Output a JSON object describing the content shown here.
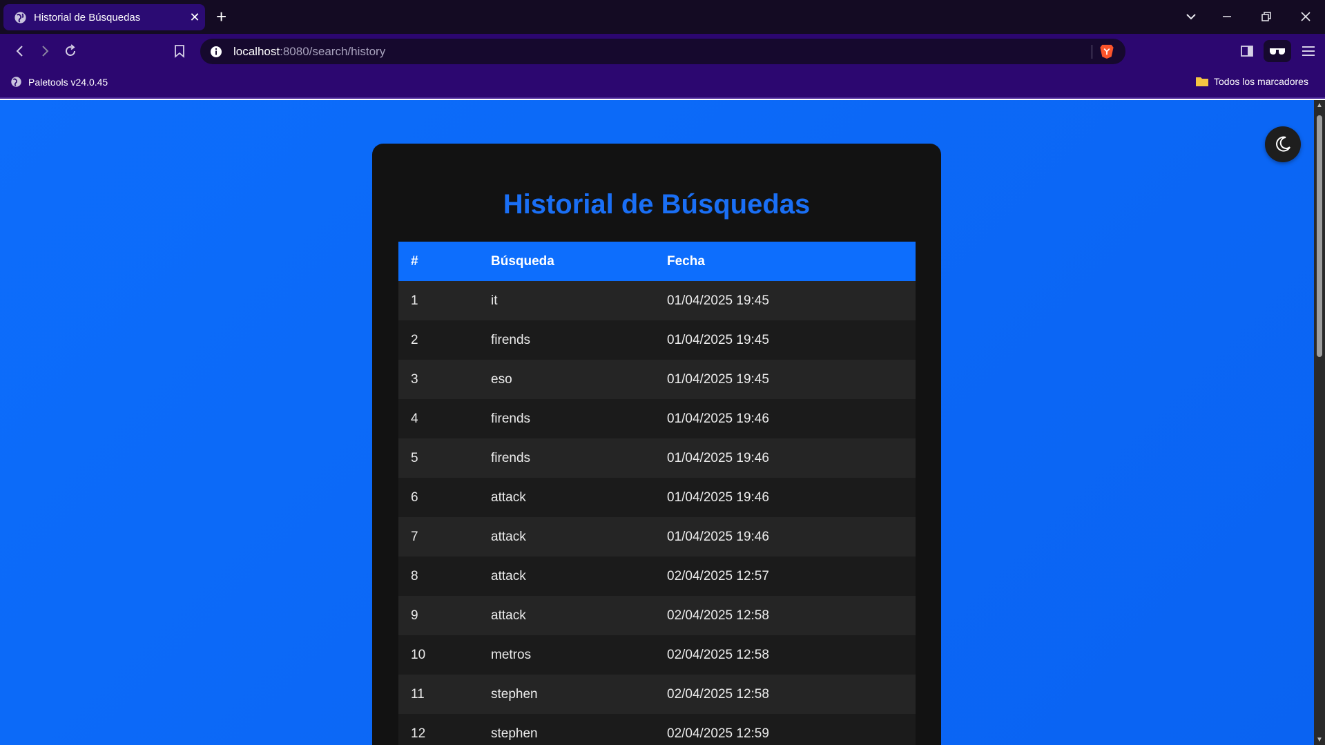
{
  "browser": {
    "tab_title": "Historial de Búsquedas",
    "new_tab": "+",
    "url_host": "localhost",
    "url_path": ":8080/search/history",
    "bookmark_item": "Paletools v24.0.45",
    "bookmarks_folder": "Todos los marcadores"
  },
  "page": {
    "title": "Historial de Búsquedas",
    "columns": [
      "#",
      "Búsqueda",
      "Fecha"
    ],
    "rows": [
      {
        "num": "1",
        "query": "it",
        "date": "01/04/2025 19:45"
      },
      {
        "num": "2",
        "query": "firends",
        "date": "01/04/2025 19:45"
      },
      {
        "num": "3",
        "query": "eso",
        "date": "01/04/2025 19:45"
      },
      {
        "num": "4",
        "query": "firends",
        "date": "01/04/2025 19:46"
      },
      {
        "num": "5",
        "query": "firends",
        "date": "01/04/2025 19:46"
      },
      {
        "num": "6",
        "query": "attack",
        "date": "01/04/2025 19:46"
      },
      {
        "num": "7",
        "query": "attack",
        "date": "01/04/2025 19:46"
      },
      {
        "num": "8",
        "query": "attack",
        "date": "02/04/2025 12:57"
      },
      {
        "num": "9",
        "query": "attack",
        "date": "02/04/2025 12:58"
      },
      {
        "num": "10",
        "query": "metros",
        "date": "02/04/2025 12:58"
      },
      {
        "num": "11",
        "query": "stephen",
        "date": "02/04/2025 12:58"
      },
      {
        "num": "12",
        "query": "stephen",
        "date": "02/04/2025 12:59"
      }
    ]
  },
  "colors": {
    "accent": "#0d6efd",
    "card": "#121212",
    "row_odd": "#252525",
    "row_even": "#1b1b1b",
    "tab_active": "#2b0b73"
  }
}
